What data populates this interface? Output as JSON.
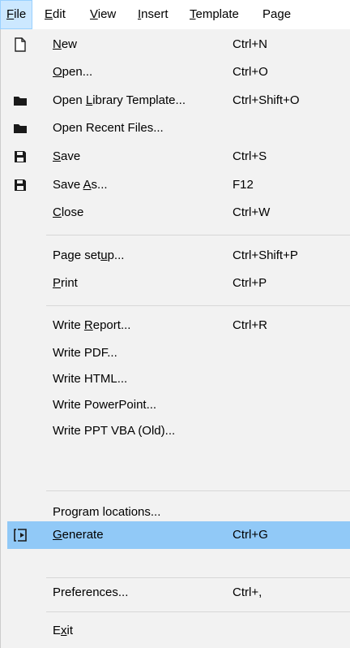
{
  "menubar": {
    "items": [
      {
        "label": "File",
        "mnemonic": "F",
        "rest": "ile",
        "active": true
      },
      {
        "label": "Edit",
        "mnemonic": "E",
        "rest": "dit"
      },
      {
        "label": "View",
        "mnemonic": "V",
        "rest": "iew"
      },
      {
        "label": "Insert",
        "mnemonic": "I",
        "rest": "nsert"
      },
      {
        "label": "Template",
        "mnemonic": "T",
        "rest": "emplate"
      },
      {
        "label": "Page",
        "mnemonic": "",
        "rest": "Page"
      }
    ]
  },
  "file_menu": {
    "items": [
      {
        "label": "New",
        "pre": "",
        "mn": "N",
        "post": "ew",
        "shortcut": "Ctrl+N",
        "icon": "new-file-icon"
      },
      {
        "label": "Open...",
        "pre": "",
        "mn": "O",
        "post": "pen...",
        "shortcut": "Ctrl+O",
        "icon": ""
      },
      {
        "label": "Open Library Template...",
        "pre": "Open ",
        "mn": "L",
        "post": "ibrary Template...",
        "shortcut": "Ctrl+Shift+O",
        "icon": "folder-icon"
      },
      {
        "label": "Open Recent Files...",
        "pre": "Open Recent Files...",
        "mn": "",
        "post": "",
        "shortcut": "",
        "icon": "folder-icon"
      },
      {
        "label": "Save",
        "pre": "",
        "mn": "S",
        "post": "ave",
        "shortcut": "Ctrl+S",
        "icon": "save-icon"
      },
      {
        "label": "Save As...",
        "pre": "Save ",
        "mn": "A",
        "post": "s...",
        "shortcut": "F12",
        "icon": "save-as-icon"
      },
      {
        "label": "Close",
        "pre": "",
        "mn": "C",
        "post": "lose",
        "shortcut": "Ctrl+W",
        "icon": ""
      },
      {
        "label": "Page setup...",
        "pre": "Page set",
        "mn": "u",
        "post": "p...",
        "shortcut": "Ctrl+Shift+P",
        "icon": ""
      },
      {
        "label": "Print",
        "pre": "",
        "mn": "P",
        "post": "rint",
        "shortcut": "Ctrl+P",
        "icon": ""
      },
      {
        "label": "Write Report...",
        "pre": "Write ",
        "mn": "R",
        "post": "eport...",
        "shortcut": "Ctrl+R",
        "icon": ""
      },
      {
        "label": "Write PDF...",
        "pre": "Write PDF...",
        "mn": "",
        "post": "",
        "shortcut": "",
        "icon": ""
      },
      {
        "label": "Write HTML...",
        "pre": "Write HTML...",
        "mn": "",
        "post": "",
        "shortcut": "",
        "icon": ""
      },
      {
        "label": "Write PowerPoint...",
        "pre": "Write PowerPoint...",
        "mn": "",
        "post": "",
        "shortcut": "",
        "icon": ""
      },
      {
        "label": "Write PPT VBA (Old)...",
        "pre": "Write PPT VBA (Old)...",
        "mn": "",
        "post": "",
        "shortcut": "",
        "icon": ""
      },
      {
        "label": "Program locations...",
        "pre": "Program locations...",
        "mn": "",
        "post": "",
        "shortcut": "",
        "icon": ""
      },
      {
        "label": "Generate",
        "pre": "",
        "mn": "G",
        "post": "enerate",
        "shortcut": "Ctrl+G",
        "icon": "generate-icon",
        "highlighted": true
      },
      {
        "label": "Preferences...",
        "pre": "Preferences...",
        "mn": "",
        "post": "",
        "shortcut": "Ctrl+,",
        "icon": ""
      },
      {
        "label": "Exit",
        "pre": "E",
        "mn": "x",
        "post": "it",
        "shortcut": "",
        "icon": ""
      }
    ]
  },
  "colors": {
    "menu_background": "#f2f2f2",
    "highlight": "#91c9f7",
    "active_menubar": "#cce8ff",
    "separator": "#d7d7d7"
  }
}
